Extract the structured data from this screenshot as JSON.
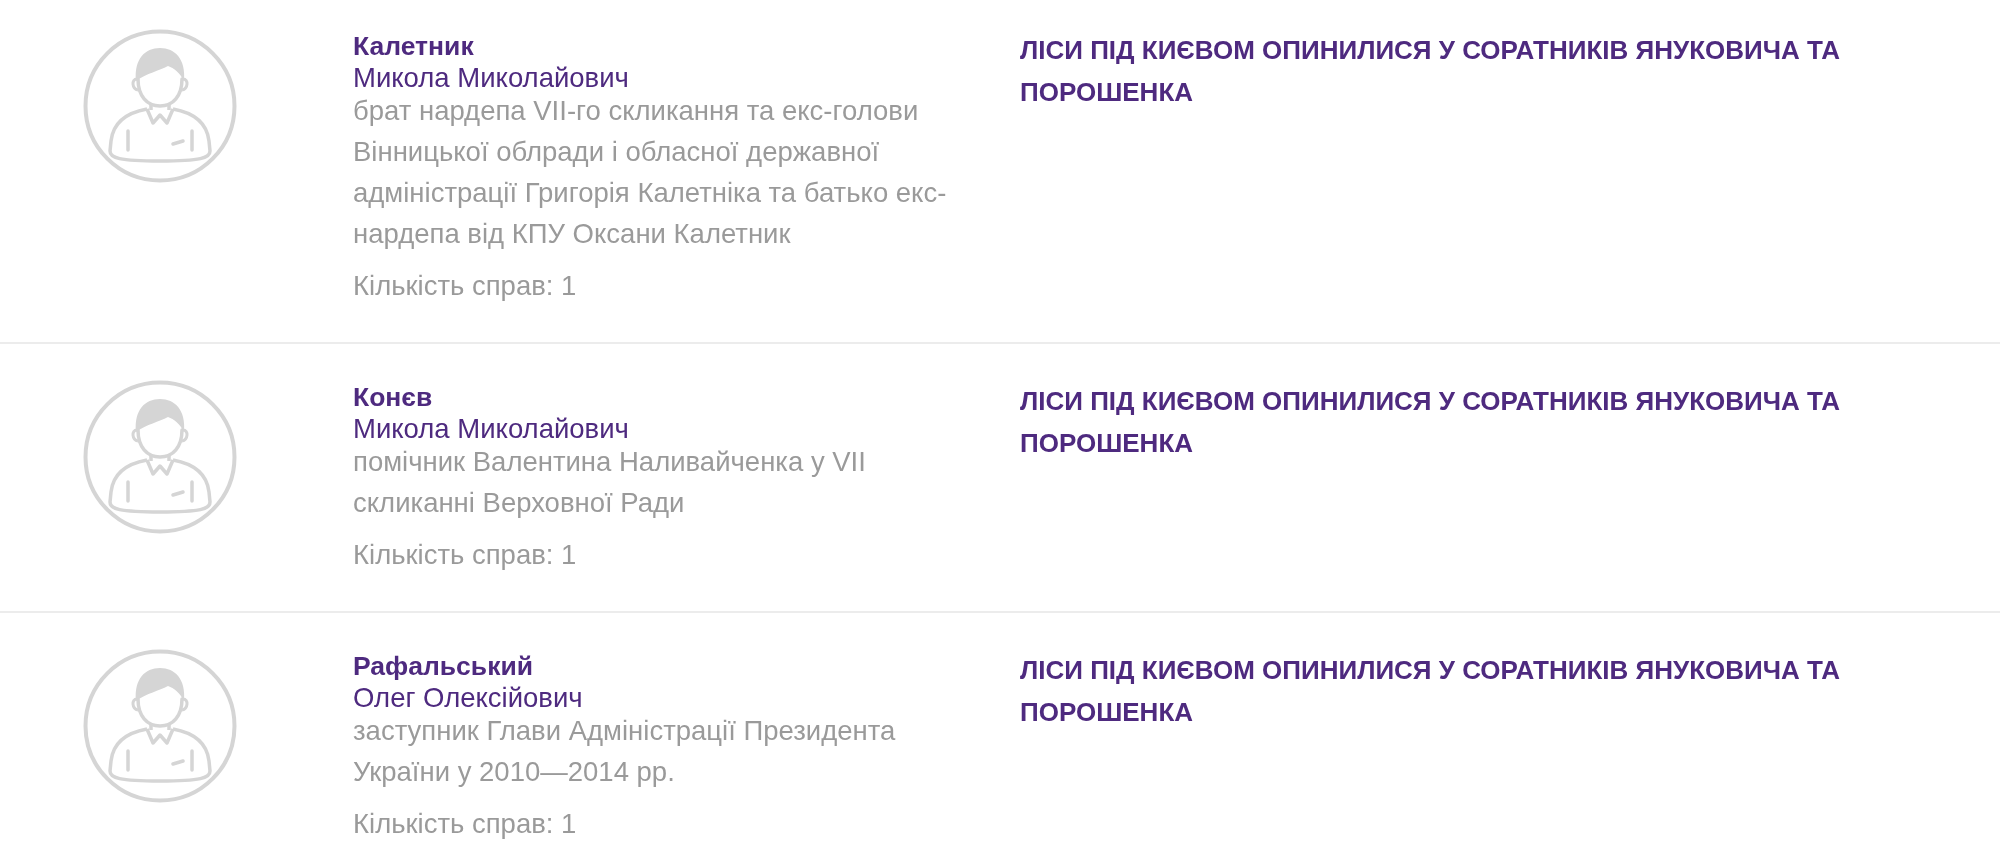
{
  "people": [
    {
      "surname": "Калетник",
      "given_names": "Микола Миколайович",
      "description": "брат нардепа VII-го скликання та екс-голови Вінницької облради і обласної державної адміністрації Григорія Калетніка та батько екс-нардепа від КПУ Оксани Калетник",
      "case_count": "Кількість справ: 1",
      "case_title": "ЛІСИ ПІД КИЄВОМ ОПИНИЛИСЯ У СОРАТНИКІВ ЯНУКОВИЧА ТА ПОРОШЕНКА"
    },
    {
      "surname": "Конєв",
      "given_names": "Микола Миколайович",
      "description": "помічник Валентина Наливайченка у VII скликанні Верховної Ради",
      "case_count": "Кількість справ: 1",
      "case_title": "ЛІСИ ПІД КИЄВОМ ОПИНИЛИСЯ У СОРАТНИКІВ ЯНУКОВИЧА ТА ПОРОШЕНКА"
    },
    {
      "surname": "Рафальський",
      "given_names": "Олег Олексійович",
      "description": "заступник Глави Адміністрації Президента України у 2010—2014 рр.",
      "case_count": "Кількість справ: 1",
      "case_title": "ЛІСИ ПІД КИЄВОМ ОПИНИЛИСЯ У СОРАТНИКІВ ЯНУКОВИЧА ТА ПОРОШЕНКА"
    }
  ]
}
